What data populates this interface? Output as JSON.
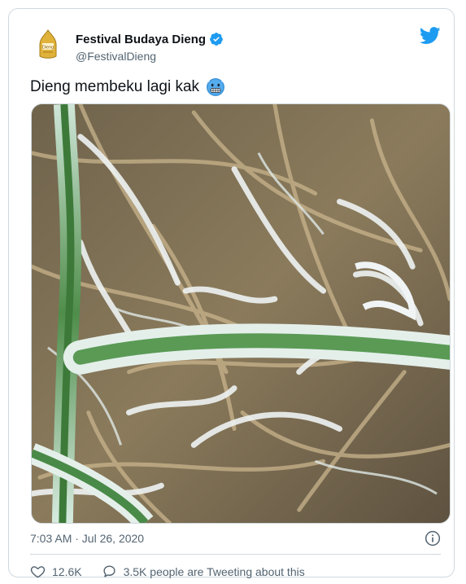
{
  "account": {
    "display_name": "Festival Budaya Dieng",
    "handle": "@FestivalDieng",
    "avatar_text": "Dieng",
    "verified": true
  },
  "tweet": {
    "text": "Dieng membeku lagi kak",
    "emoji": "cold-face-emoji",
    "timestamp": "7:03 AM · Jul 26, 2020"
  },
  "engagement": {
    "likes": "12.6K",
    "replies_text": "3.5K people are Tweeting about this"
  },
  "colors": {
    "brand_blue": "#1d9bf0",
    "text_primary": "#0f1419",
    "text_secondary": "#536471",
    "border": "#cfd9de"
  }
}
